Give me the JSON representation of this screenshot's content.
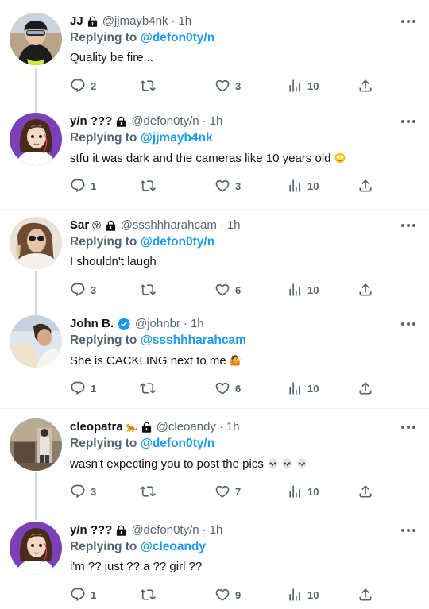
{
  "colors": {
    "accent": "#1d9bf0",
    "muted": "#536471",
    "text": "#0f1419",
    "thread_line": "#cfd9de"
  },
  "tweets": [
    {
      "name": "JJ",
      "name_emoji": "",
      "locked": true,
      "verified": false,
      "handle": "@jjmayb4nk",
      "time": "1h",
      "reply_prefix": "Replying to",
      "reply_to": "@defon0ty/n",
      "text": "Quality be fire...",
      "text_emoji": "",
      "replies": "2",
      "retweets": "",
      "likes": "3",
      "views": "10",
      "avatar_icon": "helmet-avatar"
    },
    {
      "name": "y/n ???",
      "name_emoji": "",
      "locked": true,
      "verified": false,
      "handle": "@defon0ty/n",
      "time": "1h",
      "reply_prefix": "Replying to",
      "reply_to": "@jjmayb4nk",
      "text": "stfu it was dark and the cameras like 10 years old",
      "text_emoji": "🙄",
      "replies": "1",
      "retweets": "",
      "likes": "3",
      "views": "10",
      "avatar_icon": "cartoon-girl-avatar"
    },
    {
      "name": "Sar",
      "name_emoji": "😚",
      "locked": true,
      "verified": false,
      "handle": "@ssshhharahcam",
      "time": "1h",
      "reply_prefix": "Replying to",
      "reply_to": "@defon0ty/n",
      "text": "I shouldn't laugh",
      "text_emoji": "",
      "replies": "3",
      "retweets": "",
      "likes": "6",
      "views": "10",
      "avatar_icon": "photo-woman-avatar"
    },
    {
      "name": "John B.",
      "name_emoji": "",
      "locked": false,
      "verified": true,
      "handle": "@johnbr",
      "time": "1h",
      "reply_prefix": "Replying to",
      "reply_to": "@ssshhharahcam",
      "text": "She is CACKLING next to me",
      "text_emoji": "🤷",
      "replies": "1",
      "retweets": "",
      "likes": "6",
      "views": "10",
      "avatar_icon": "photo-man-avatar"
    },
    {
      "name": "cleopatra",
      "name_emoji": "🐆",
      "locked": true,
      "verified": false,
      "handle": "@cleoandy",
      "time": "1h",
      "reply_prefix": "Replying to",
      "reply_to": "@defon0ty/n",
      "text": "wasn't expecting you to post the pics",
      "text_emoji": "💀 💀 💀",
      "replies": "3",
      "retweets": "",
      "likes": "7",
      "views": "10",
      "avatar_icon": "photo-room-avatar"
    },
    {
      "name": "y/n ???",
      "name_emoji": "",
      "locked": true,
      "verified": false,
      "handle": "@defon0ty/n",
      "time": "1h",
      "reply_prefix": "Replying to",
      "reply_to": "@cleoandy",
      "text": "i'm ?? just ?? a ?? girl ??",
      "text_emoji": "",
      "replies": "1",
      "retweets": "",
      "likes": "9",
      "views": "10",
      "avatar_icon": "cartoon-girl-avatar"
    }
  ]
}
